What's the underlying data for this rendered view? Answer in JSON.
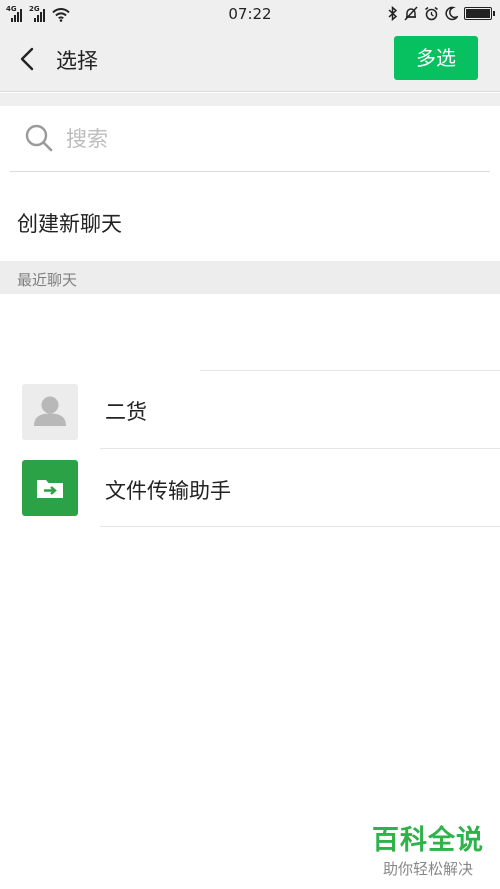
{
  "status_bar": {
    "time": "07:22",
    "network_1": "4G",
    "network_2": "2G",
    "battery_level": 1.0
  },
  "header": {
    "title": "选择",
    "multi_select_label": "多选"
  },
  "search": {
    "placeholder": "搜索",
    "value": ""
  },
  "new_chat": {
    "label": "创建新聊天"
  },
  "recent": {
    "section_label": "最近聊天",
    "contacts": [
      {
        "name": "二货",
        "avatar_icon": "default-person-icon"
      },
      {
        "name": "文件传输助手",
        "avatar_icon": "file-transfer-icon"
      }
    ]
  },
  "watermark": {
    "title": "百科全说",
    "subtitle": "助你轻松解决"
  },
  "colors": {
    "accent": "#07c160",
    "file_transfer": "#2ba245",
    "background": "#efefef"
  }
}
